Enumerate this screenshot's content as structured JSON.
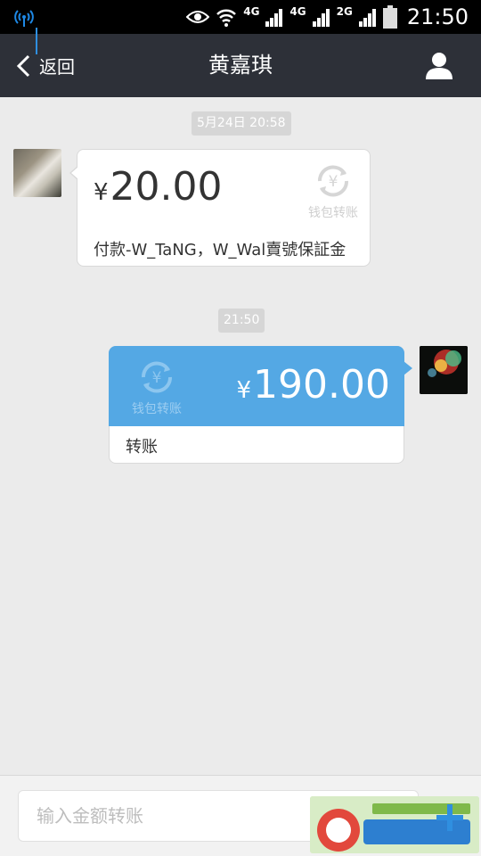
{
  "status_bar": {
    "network_labels": [
      "4G",
      "4G",
      "2G"
    ],
    "time": "21:50"
  },
  "header": {
    "back_label": "返回",
    "title": "黄嘉琪"
  },
  "messages": [
    {
      "timestamp": "5月24日 20:58",
      "direction": "received",
      "currency": "¥",
      "amount": "20.00",
      "service_label": "钱包转账",
      "note": "付款-W_TaNG，W_Wal賣號保証金"
    },
    {
      "timestamp": "21:50",
      "direction": "sent",
      "currency": "¥",
      "amount": "190.00",
      "service_label": "钱包转账",
      "note": "转账"
    }
  ],
  "input_bar": {
    "placeholder": "输入金额转账"
  },
  "colors": {
    "header_bg": "#2d3038",
    "sent_bubble": "#54a8e4",
    "chat_bg": "#ebebeb"
  },
  "icons": [
    "signal-icon",
    "eye-icon",
    "wifi-icon",
    "battery-icon",
    "back-chevron-icon",
    "profile-icon",
    "yen-transfer-icon",
    "plus-icon"
  ]
}
